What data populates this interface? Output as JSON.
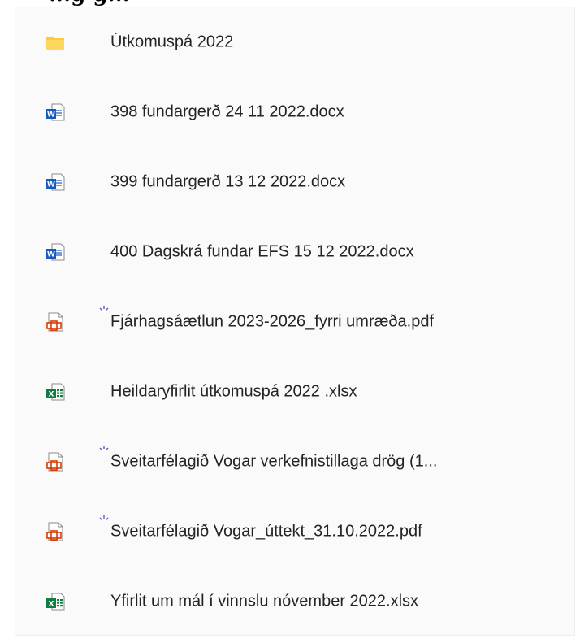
{
  "header": {
    "cropped_text": "...g g..."
  },
  "files": [
    {
      "name": "Útkomuspá 2022",
      "icon": "folder-icon",
      "syncing": false
    },
    {
      "name": "398 fundargerð 24 11 2022.docx",
      "icon": "word-icon",
      "syncing": false
    },
    {
      "name": "399 fundargerð 13 12 2022.docx",
      "icon": "word-icon",
      "syncing": false
    },
    {
      "name": "400 Dagskrá fundar EFS 15 12 2022.docx",
      "icon": "word-icon",
      "syncing": false
    },
    {
      "name": "Fjárhagsáætlun 2023-2026_fyrri umræða.pdf",
      "icon": "pdf-icon",
      "syncing": true
    },
    {
      "name": "Heildaryfirlit útkomuspá 2022 .xlsx",
      "icon": "excel-icon",
      "syncing": false
    },
    {
      "name": "Sveitarfélagið Vogar verkefnistillaga drög (1...",
      "icon": "pdf-icon",
      "syncing": true
    },
    {
      "name": "Sveitarfélagið Vogar_úttekt_31.10.2022.pdf",
      "icon": "pdf-icon",
      "syncing": true
    },
    {
      "name": "Yfirlit um mál í vinnslu nóvember 2022.xlsx",
      "icon": "excel-icon",
      "syncing": false
    }
  ],
  "colors": {
    "folder": "#FFC83D",
    "word": "#185ABD",
    "excel": "#107C41",
    "pdf": "#D83B01",
    "sync": "#5B5FC7"
  }
}
